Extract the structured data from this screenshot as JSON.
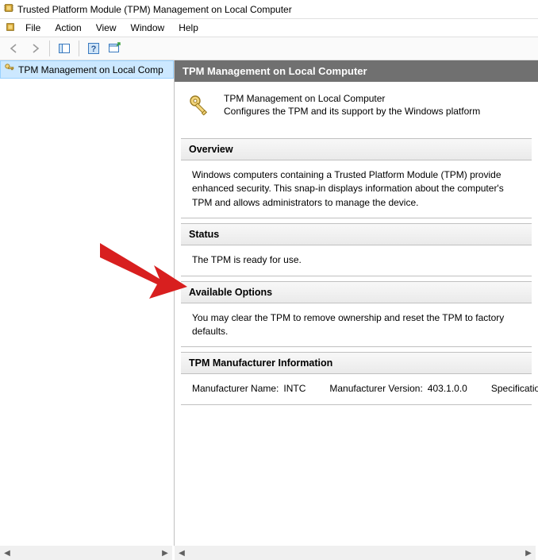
{
  "window": {
    "title": "Trusted Platform Module (TPM) Management on Local Computer"
  },
  "menu": {
    "file": "File",
    "action": "Action",
    "view": "View",
    "window": "Window",
    "help": "Help"
  },
  "tree": {
    "selected_label": "TPM Management on Local Comp"
  },
  "content": {
    "header": "TPM Management on Local Computer",
    "intro_title": "TPM Management on Local Computer",
    "intro_subtitle": "Configures the TPM and its support by the Windows platform"
  },
  "sections": {
    "overview": {
      "title": "Overview",
      "body": "Windows computers containing a Trusted Platform Module (TPM) provide enhanced security. This snap-in displays information about the computer's TPM and allows administrators to manage the device."
    },
    "status": {
      "title": "Status",
      "body": "The TPM is ready for use."
    },
    "options": {
      "title": "Available Options",
      "body": "You may clear the TPM to remove ownership and reset the TPM to factory defaults."
    },
    "mfr": {
      "title": "TPM Manufacturer Information",
      "name_label": "Manufacturer Name:",
      "name_value": "INTC",
      "version_label": "Manufacturer Version:",
      "version_value": "403.1.0.0",
      "spec_label": "Specification Ver"
    }
  }
}
